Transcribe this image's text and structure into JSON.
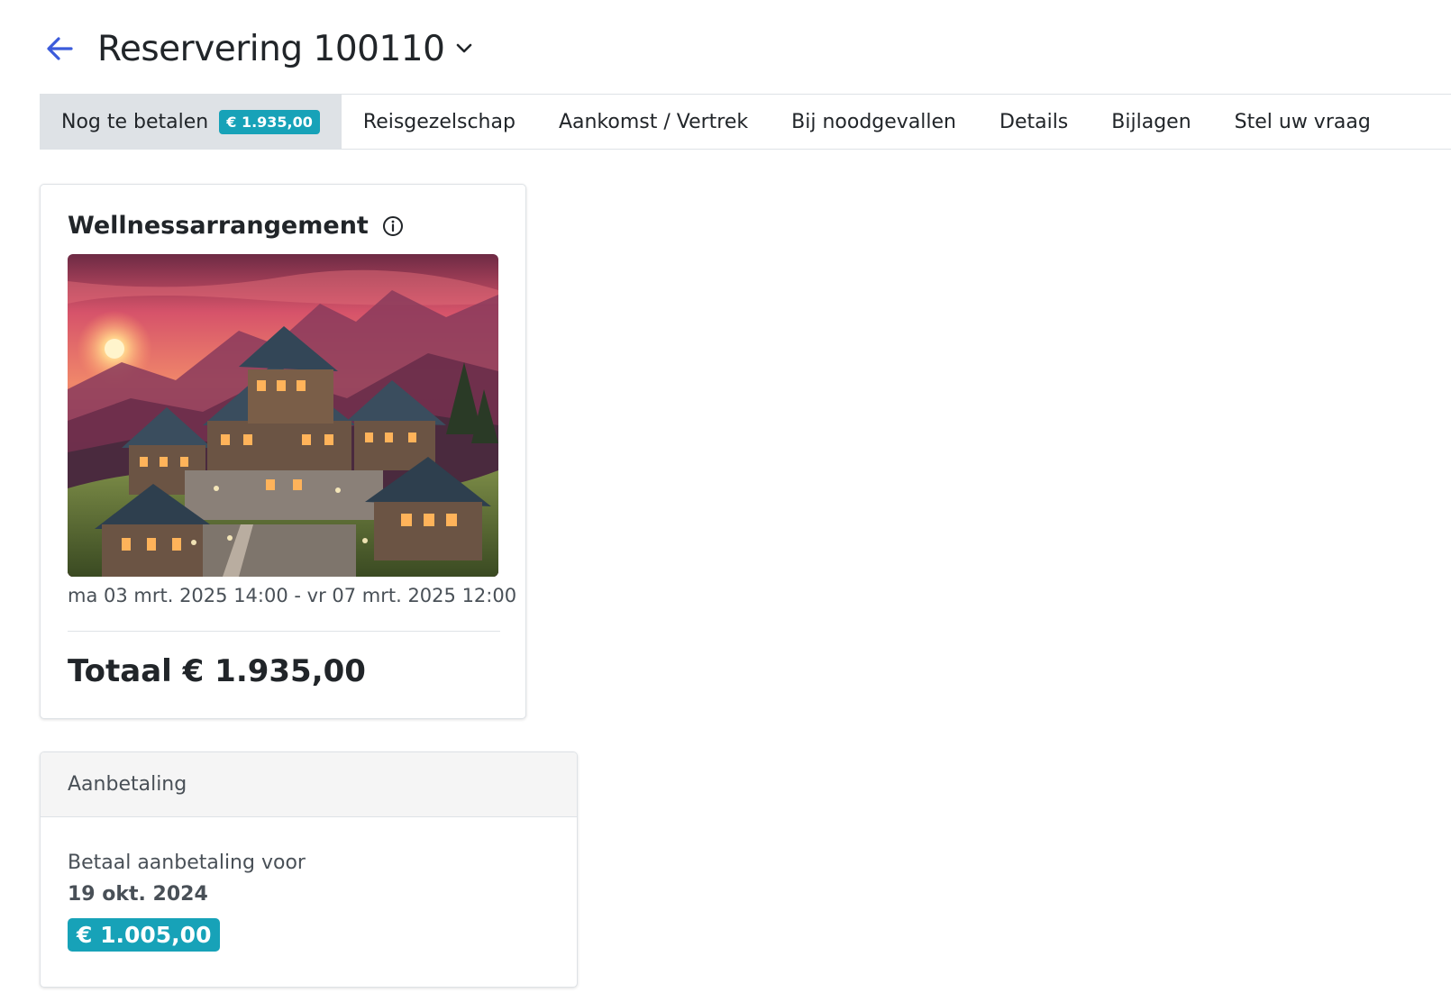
{
  "header": {
    "title": "Reservering 100110",
    "back_icon": "arrow-left-icon",
    "dropdown_icon": "chevron-down-icon",
    "accent_color": "#3b5bdb"
  },
  "tabs": [
    {
      "label": "Nog te betalen",
      "badge": "€ 1.935,00",
      "active": true
    },
    {
      "label": "Reisgezelschap"
    },
    {
      "label": "Aankomst / Vertrek"
    },
    {
      "label": "Bij noodgevallen"
    },
    {
      "label": "Details"
    },
    {
      "label": "Bijlagen"
    },
    {
      "label": "Stel uw vraag"
    }
  ],
  "booking": {
    "title": "Wellnessarrangement",
    "info_icon": "info-circle-icon",
    "image": "mountain-chalet-sunset-photo",
    "dates": "ma 03 mrt. 2025 14:00 - vr 07 mrt. 2025 12:00",
    "total": "Totaal € 1.935,00"
  },
  "payment": {
    "header": "Aanbetaling",
    "label": "Betaal aanbetaling voor",
    "due_date": "19 okt. 2024",
    "amount": "€ 1.005,00",
    "badge_color": "#17a2b8"
  }
}
